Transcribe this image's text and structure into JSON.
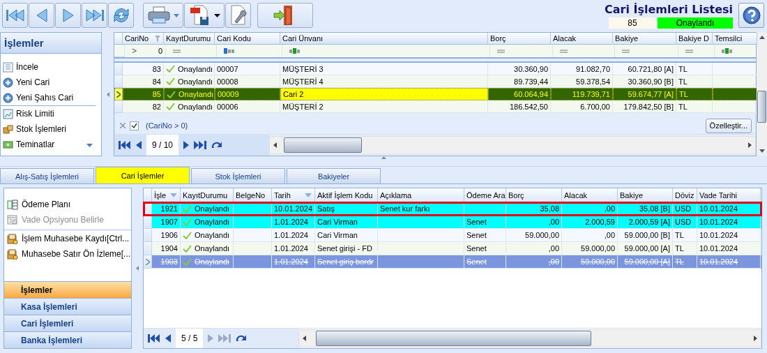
{
  "title": "Cari İşlemleri Listesi",
  "record": {
    "number": "85",
    "status": "Onaylandı"
  },
  "side_panel": {
    "title": "İşlemler",
    "items": [
      {
        "label": "İncele",
        "separator_before": false
      },
      {
        "label": "Yeni Cari",
        "separator_before": false
      },
      {
        "label": "Yeni Şahıs Cari",
        "separator_before": false
      },
      {
        "label": "Risk Limiti",
        "separator_before": true
      },
      {
        "label": "Stok İşlemleri",
        "separator_before": false
      },
      {
        "label": "Teminatlar",
        "separator_before": false
      }
    ]
  },
  "customers_grid": {
    "columns": [
      {
        "label": "CariNo",
        "kind": "number",
        "filtered": true,
        "focused": false,
        "filter": {
          "kind": "compare",
          "operator": ">",
          "value": "0"
        }
      },
      {
        "label": "KayıtDurumu",
        "kind": "status",
        "filtered": false,
        "focused": false,
        "filter": {
          "kind": "equals"
        }
      },
      {
        "label": "Cari Kodu",
        "kind": "text",
        "filtered": false,
        "focused": false,
        "filter": {
          "kind": "starts-with"
        }
      },
      {
        "label": "Cari Ünvanı",
        "kind": "text",
        "filtered": false,
        "focused": true,
        "filter": {
          "kind": "contains"
        }
      },
      {
        "label": "Borç",
        "kind": "number",
        "filtered": false,
        "focused": false,
        "filter": {
          "kind": "equals"
        }
      },
      {
        "label": "Alacak",
        "kind": "number",
        "filtered": false,
        "focused": false,
        "filter": {
          "kind": "equals"
        }
      },
      {
        "label": "Bakiye",
        "kind": "number",
        "filtered": false,
        "focused": false,
        "filter": {
          "kind": "equals"
        }
      },
      {
        "label": "Bakiye D",
        "kind": "text",
        "filtered": false,
        "focused": false,
        "filter": {
          "kind": "equals"
        }
      },
      {
        "label": "Temsilci",
        "kind": "text",
        "filtered": false,
        "focused": false,
        "filter": {
          "kind": "contains"
        }
      }
    ],
    "rows": [
      {
        "cells": [
          "83",
          "Onaylandı",
          "00007",
          "MÜŞTERİ 3",
          "30.360,90",
          "91.082,70",
          "60.721,80 [A]",
          "TL"
        ],
        "selected": false
      },
      {
        "cells": [
          "84",
          "Onaylandı",
          "00008",
          "MÜŞTERİ 4",
          "89.739,44",
          "59.378,54",
          "30.360,90 [B]",
          "TL"
        ],
        "selected": false
      },
      {
        "cells": [
          "85",
          "Onaylandı",
          "00009",
          "Cari 2",
          "60.064,94",
          "119.739,71",
          "59.674,77 [A]",
          "TL"
        ],
        "selected": true
      },
      {
        "cells": [
          "82",
          "Onaylandı",
          "00006",
          "MÜŞTERİ 2",
          "186.542,50",
          "6.700,00",
          "179.842,50 [B]",
          "TL"
        ],
        "selected": false
      }
    ],
    "filter_bar": {
      "enabled": true,
      "expression": "(CariNo > 0)"
    },
    "customize_button": "Özelleştir...",
    "pager": {
      "position": "9 / 10",
      "next_disabled": false
    }
  },
  "tabs": [
    {
      "label": "Alış-Satış İşlemleri",
      "selected": false
    },
    {
      "label": "Cari İşlemler",
      "selected": true
    },
    {
      "label": "Stok İşlemleri",
      "selected": false
    },
    {
      "label": "Bakiyeler",
      "selected": false
    }
  ],
  "actions": [
    {
      "label": "Ödeme Planı",
      "disabled": false,
      "separator_before": false
    },
    {
      "label": "Vade Opsiyonu Belirle",
      "disabled": true,
      "separator_before": false
    },
    {
      "label": "İşlem Muhasebe Kaydı[Ctrl...",
      "disabled": false,
      "separator_before": true
    },
    {
      "label": "Muhasebe Satır Ön İzleme[...",
      "disabled": false,
      "separator_before": false
    }
  ],
  "groups": [
    {
      "label": "İşlemler",
      "selected": true
    },
    {
      "label": "Kasa İşlemleri",
      "selected": false
    },
    {
      "label": "Cari İşlemleri",
      "selected": false
    },
    {
      "label": "Banka İşlemleri",
      "selected": false
    }
  ],
  "transactions_grid": {
    "columns": [
      {
        "label": "İşle",
        "kind": "number",
        "sorted": true
      },
      {
        "label": "KayıtDurumu",
        "kind": "status",
        "sorted": false
      },
      {
        "label": "BelgeNo",
        "kind": "text",
        "sorted": false
      },
      {
        "label": "Tarih",
        "kind": "text",
        "sorted": true
      },
      {
        "label": "Aktif İşlem Kodu",
        "kind": "text",
        "sorted": false
      },
      {
        "label": "Açıklama",
        "kind": "text",
        "sorted": false
      },
      {
        "label": "Ödeme Ara",
        "kind": "text",
        "sorted": false
      },
      {
        "label": "Borç",
        "kind": "number",
        "sorted": false
      },
      {
        "label": "Alacak",
        "kind": "number",
        "sorted": false
      },
      {
        "label": "Bakiye",
        "kind": "number",
        "sorted": false
      },
      {
        "label": "Döviz",
        "kind": "text",
        "sorted": false
      },
      {
        "label": "Vade Tarihi",
        "kind": "text",
        "sorted": false
      }
    ],
    "rows": [
      {
        "cells": [
          "1921",
          "Onaylandı",
          "",
          "10.01.2024",
          "Satış",
          "Senet kur farkı",
          "",
          "35,08",
          ",00",
          "35,08 [B]",
          "USD",
          "10.01.2024"
        ],
        "color": "#00ffff",
        "highlighted": true,
        "selected": false,
        "struck": false
      },
      {
        "cells": [
          "1907",
          "Onaylandı",
          "",
          "1.01.2024",
          "Cari Virman",
          "",
          "Senet",
          ",00",
          "2.000,59",
          "2.000,59 [A]",
          "USD",
          "10.01.2024"
        ],
        "color": "#00ffff",
        "highlighted": false,
        "selected": false,
        "struck": false
      },
      {
        "cells": [
          "1906",
          "Onaylandı",
          "",
          "1.01.2024",
          "Cari Virman",
          "",
          "Senet",
          "59.000,00",
          ",00",
          "59.000,00 [B]",
          "TL",
          "10.01.2024"
        ],
        "highlighted": false,
        "selected": false,
        "struck": false
      },
      {
        "cells": [
          "1904",
          "Onaylandı",
          "",
          "1.01.2024",
          "Senet girişi - FD",
          "",
          "Senet",
          ",00",
          "59.000,00",
          "59.000,00 [A]",
          "TL",
          "10.01.2024"
        ],
        "highlighted": false,
        "selected": false,
        "struck": false
      },
      {
        "cells": [
          "1903",
          "Onaylandı",
          "",
          "1.01.2024",
          "Senet giriş bordr",
          "",
          "Senet",
          ",00",
          "59.000,00",
          "59.000,00 [A]",
          "TL",
          "10.01.2024"
        ],
        "highlighted": false,
        "selected": true,
        "struck": true
      }
    ],
    "pager": {
      "position": "5 / 5",
      "next_disabled": true
    }
  }
}
